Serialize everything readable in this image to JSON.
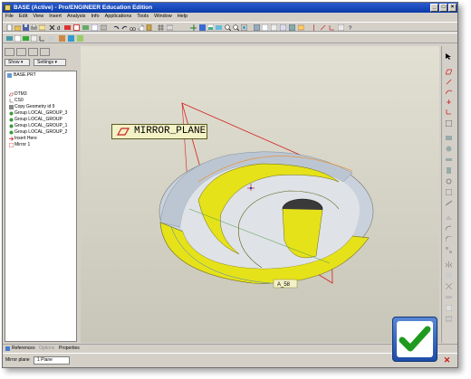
{
  "window": {
    "title": "BASE (Active) - Pro/ENGINEER Education Edition",
    "controls": [
      "_",
      "□",
      "×"
    ]
  },
  "menu": {
    "items": [
      "File",
      "Edit",
      "View",
      "Insert",
      "Analysis",
      "Info",
      "Applications",
      "Tools",
      "Window",
      "Help"
    ]
  },
  "model_tree": {
    "show_label": "Show ▾",
    "settings_label": "Settings ▾",
    "items": [
      "BASE.PRT",
      "DTM3",
      "CS0",
      "Copy Geometry id 9",
      "Group LOCAL_GROUP_3",
      "Group LOCAL_GROUP",
      "Group LOCAL_GROUP_1",
      "Group LOCAL_GROUP_2",
      "Insert Here",
      "Mirror 1"
    ]
  },
  "viewport": {
    "callout_text": "MIRROR_PLANE",
    "dim_label": "A_58"
  },
  "bottom_tabs": {
    "references": "References",
    "options": "Options",
    "properties": "Properties"
  },
  "status": {
    "mirror_plane_label": "Mirror plane",
    "mirror_plane_value": "1 Plane"
  },
  "colors": {
    "titlebar": "#0a3aa8",
    "accent_check": "#1f9a1f",
    "part_yellow": "#e6e21a",
    "part_blue": "#aab8c8",
    "plane_red": "#d21e1e",
    "close_red": "#d01818"
  }
}
